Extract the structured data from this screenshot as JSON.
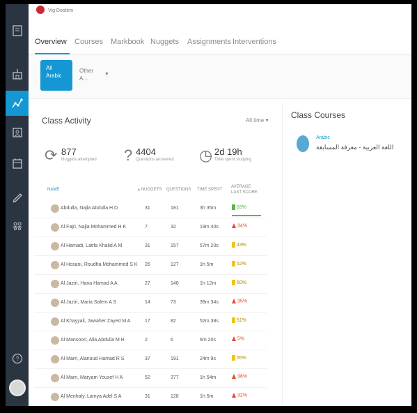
{
  "app": {
    "brand_text": "Vig Dostem"
  },
  "tabs": [
    {
      "label": "Overview",
      "active": true
    },
    {
      "label": "Courses",
      "active": false
    },
    {
      "label": "Markbook",
      "active": false
    },
    {
      "label": "Nuggets",
      "active": false
    },
    {
      "label": "Assignments",
      "active": false
    },
    {
      "label": "Interventions",
      "active": false
    }
  ],
  "filters": {
    "chip_line1": "All",
    "chip_line2": "Arabic",
    "other_line1": "Other",
    "other_line2": "A..."
  },
  "activity": {
    "title": "Class Activity",
    "time_filter": "All time",
    "stats": [
      {
        "icon": "refresh-icon",
        "value": "877",
        "label": "Nuggets attempted"
      },
      {
        "icon": "question-icon",
        "value": "4404",
        "label": "Questions answered"
      },
      {
        "icon": "stopwatch-icon",
        "value": "2d 19h",
        "label": "Time spent studying"
      }
    ],
    "columns": {
      "name": "NAME",
      "nuggets": "NUGGETS",
      "questions": "QUESTIONS",
      "time": "TIME SPENT",
      "score": "AVERAGE LAST SCORE"
    },
    "rows": [
      {
        "name": "Abdulla, Najla Abdulla H D",
        "nuggets": "31",
        "questions": "181",
        "time": "3h 35m",
        "score": "83%",
        "status": "green"
      },
      {
        "name": "Al Fajri, Najla Mohammed H K",
        "nuggets": "7",
        "questions": "32",
        "time": "19m 40s",
        "score": "34%",
        "status": "red"
      },
      {
        "name": "Al Hamadi, Latifa Khalid A M",
        "nuggets": "31",
        "questions": "157",
        "time": "57m 20s",
        "score": "43%",
        "status": "yellow"
      },
      {
        "name": "Al Hosani, Roudha Mohammed S K",
        "nuggets": "26",
        "questions": "127",
        "time": "1h 5m",
        "score": "52%",
        "status": "yellow"
      },
      {
        "name": "Al Jaziri, Hana Hamad A A",
        "nuggets": "27",
        "questions": "140",
        "time": "1h 12m",
        "score": "60%",
        "status": "yellow"
      },
      {
        "name": "Al Jaziri, Maria Salem A S",
        "nuggets": "14",
        "questions": "73",
        "time": "39m 34s",
        "score": "35%",
        "status": "red"
      },
      {
        "name": "Al Khayyali, Jawaher Zayed M A",
        "nuggets": "17",
        "questions": "82",
        "time": "52m 38s",
        "score": "51%",
        "status": "yellow"
      },
      {
        "name": "Al Mansoori, Alia Abdulla M R",
        "nuggets": "2",
        "questions": "6",
        "time": "6m 20s",
        "score": "5%",
        "status": "red"
      },
      {
        "name": "Al Marri, Alanoud Hamad R S",
        "nuggets": "37",
        "questions": "191",
        "time": "24m 9s",
        "score": "55%",
        "status": "yellow"
      },
      {
        "name": "Al Marri, Maryam Yousef H A",
        "nuggets": "52",
        "questions": "377",
        "time": "1h 54m",
        "score": "38%",
        "status": "red"
      },
      {
        "name": "Al Menhaly, Lamya Adel S A",
        "nuggets": "31",
        "questions": "128",
        "time": "1h 5m",
        "score": "32%",
        "status": "red"
      }
    ]
  },
  "courses": {
    "title": "Class Courses",
    "items": [
      {
        "small": "Arabic",
        "name": "اللغة العربية - معرفة المسابقة"
      }
    ]
  },
  "colors": {
    "accent": "#1597d4",
    "sidebar": "#2b3441",
    "green": "#58b947",
    "yellow": "#f3c21e",
    "red": "#e64a2e"
  }
}
